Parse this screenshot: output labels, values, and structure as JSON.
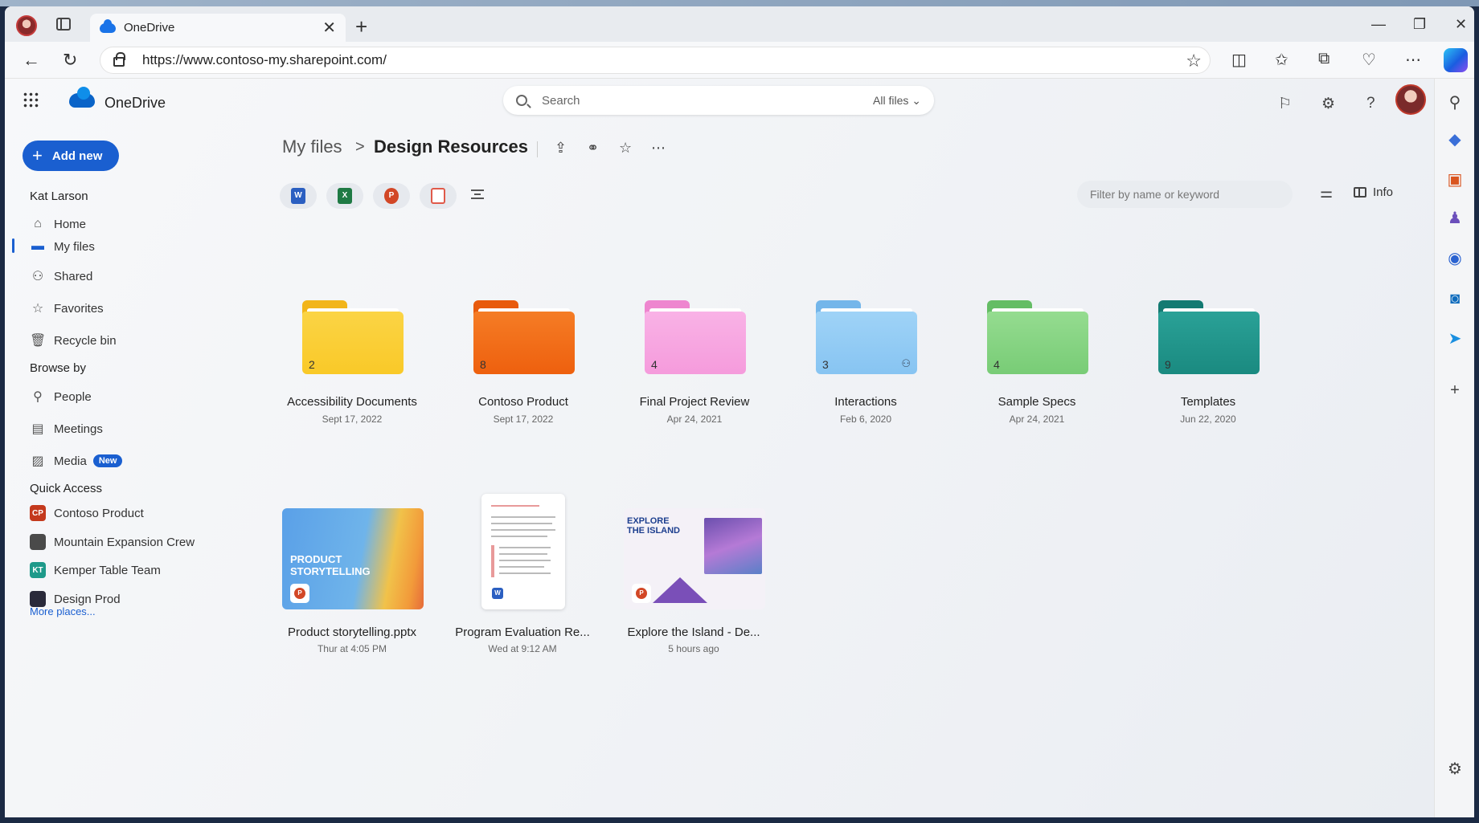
{
  "browser": {
    "tab_title": "OneDrive",
    "tab_close": "✕",
    "new_tab": "+",
    "url": "https://www.contoso-my.sharepoint.com/",
    "window_controls": {
      "minimize": "—",
      "maximize": "❐",
      "close": "✕"
    }
  },
  "header": {
    "app_name": "OneDrive",
    "search_placeholder": "Search",
    "search_scope": "All files ⌄"
  },
  "sidebar": {
    "add_new": "Add new",
    "owner": "Kat Larson",
    "items": [
      {
        "label": "Home",
        "icon": "home-icon",
        "glyph": "⌂"
      },
      {
        "label": "My files",
        "icon": "folder-icon",
        "glyph": "▬"
      },
      {
        "label": "Shared",
        "icon": "people-icon",
        "glyph": "⚇"
      },
      {
        "label": "Favorites",
        "icon": "star-icon",
        "glyph": "☆"
      },
      {
        "label": "Recycle bin",
        "icon": "trash-icon",
        "glyph": "🗑"
      }
    ],
    "browse_by_heading": "Browse by",
    "browse_items": [
      {
        "label": "People",
        "icon": "person-icon",
        "glyph": "⚲"
      },
      {
        "label": "Meetings",
        "icon": "calendar-icon",
        "glyph": "▤"
      },
      {
        "label": "Media",
        "icon": "image-icon",
        "glyph": "▨",
        "badge": "New"
      }
    ],
    "quick_access_heading": "Quick Access",
    "quick_access": [
      {
        "label": "Contoso Product",
        "abbr": "CP",
        "color": "#c4391d"
      },
      {
        "label": "Mountain Expansion Crew",
        "abbr": "",
        "color": "#4a4a4a"
      },
      {
        "label": "Kemper Table Team",
        "abbr": "KT",
        "color": "#1e9a8a"
      },
      {
        "label": "Design Prod",
        "abbr": "",
        "color": "#2a2a3a"
      }
    ],
    "more_places": "More places..."
  },
  "breadcrumb": {
    "parent": "My files",
    "separator": ">",
    "current": "Design Resources"
  },
  "toolbar": {
    "filter_placeholder": "Filter by name or keyword",
    "info_label": "Info",
    "type_filters": [
      {
        "name": "word-filter",
        "letter": "W",
        "color": "#2b5fc1"
      },
      {
        "name": "excel-filter",
        "letter": "X",
        "color": "#1f7a44"
      },
      {
        "name": "powerpoint-filter",
        "letter": "P",
        "color": "#d24726"
      },
      {
        "name": "pdf-filter",
        "letter": "",
        "color": "#e05a4a"
      }
    ]
  },
  "folders": [
    {
      "name": "Accessibility Documents",
      "date": "Sept 17, 2022",
      "count": "2",
      "color": "#f9c928",
      "tab": "#f2b51a",
      "shared": false
    },
    {
      "name": "Contoso Product",
      "date": "Sept 17, 2022",
      "count": "8",
      "color": "#f26b12",
      "tab": "#e85a0c",
      "shared": false
    },
    {
      "name": "Final Project Review",
      "date": "Apr 24, 2021",
      "count": "4",
      "color": "#f7a0df",
      "tab": "#ee86cf",
      "shared": false
    },
    {
      "name": "Interactions",
      "date": "Feb 6, 2020",
      "count": "3",
      "color": "#8cc8f4",
      "tab": "#74b6ea",
      "shared": true
    },
    {
      "name": "Sample Specs",
      "date": "Apr 24, 2021",
      "count": "4",
      "color": "#7ed07c",
      "tab": "#64bd64",
      "shared": false
    },
    {
      "name": "Templates",
      "date": "Jun 22, 2020",
      "count": "9",
      "color": "#1d8f86",
      "tab": "#137a72",
      "shared": false
    }
  ],
  "files": [
    {
      "name": "Product storytelling.pptx",
      "date": "Thur at 4:05 PM",
      "thumb_text": "PRODUCT\nSTORYTELLING",
      "app": "P"
    },
    {
      "name": "Program Evaluation Re...",
      "date": "Wed at 9:12 AM",
      "app": "W"
    },
    {
      "name": "Explore the Island - De...",
      "date": "5 hours ago",
      "thumb_text": "EXPLORE\nTHE ISLAND",
      "app": "P"
    }
  ]
}
